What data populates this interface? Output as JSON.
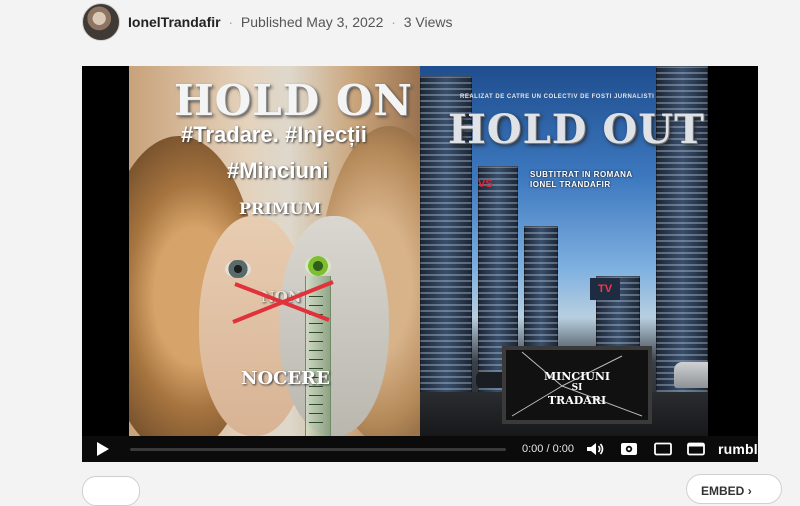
{
  "header": {
    "channel_name": "IonelTrandafir",
    "published": "Published May 3, 2022",
    "views": "3 Views",
    "separator": "·"
  },
  "thumbnail": {
    "left": {
      "title": "HOLD ON",
      "tags_line1": "#Tradare. #Injecții",
      "tags_line2": "#Minciuni",
      "word_top": "PRIMUM",
      "word_crossed": "NON",
      "word_bottom": "NOCERE"
    },
    "right": {
      "tagline": "REALIZAT DE CATRE UN COLECTIV DE FOSTI JURNALISTI",
      "title": "HOLD OUT",
      "credit_line1": "SUBTITRAT IN ROMANA",
      "credit_line2": "IONEL TRANDAFIR",
      "tv_line1": "MINCIUNI",
      "tv_line2": "SI",
      "tv_line3": "TRADARI",
      "tv_sign": "TV",
      "red_mark": "VS"
    }
  },
  "player": {
    "time": "0:00 / 0:00",
    "progress": 0,
    "brand": "rumble",
    "accent_color": "#85c742"
  },
  "actions": {
    "embed_label": "EMBED",
    "embed_chevron": "›"
  }
}
